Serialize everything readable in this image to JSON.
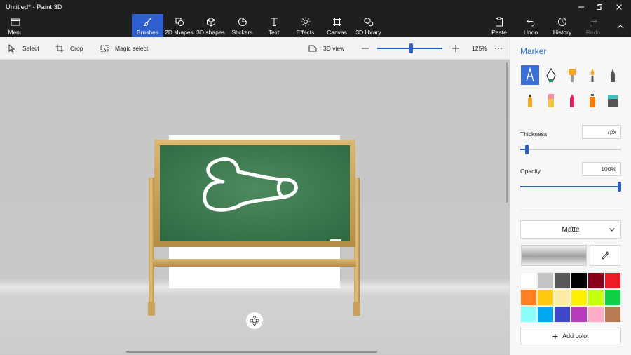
{
  "window": {
    "title": "Untitled* - Paint 3D"
  },
  "ribbon": {
    "menu": "Menu",
    "tools": [
      {
        "id": "brushes",
        "label": "Brushes",
        "icon": "brush-icon",
        "active": true
      },
      {
        "id": "2d-shapes",
        "label": "2D shapes",
        "icon": "2d-shapes-icon"
      },
      {
        "id": "3d-shapes",
        "label": "3D shapes",
        "icon": "cube-icon"
      },
      {
        "id": "stickers",
        "label": "Stickers",
        "icon": "sticker-icon"
      },
      {
        "id": "text",
        "label": "Text",
        "icon": "text-icon"
      },
      {
        "id": "effects",
        "label": "Effects",
        "icon": "sun-icon"
      },
      {
        "id": "canvas",
        "label": "Canvas",
        "icon": "canvas-icon"
      },
      {
        "id": "3d-library",
        "label": "3D library",
        "icon": "library-icon"
      }
    ],
    "paste": "Paste",
    "undo": "Undo",
    "history": "History",
    "redo": "Redo"
  },
  "toolbar": {
    "select": "Select",
    "crop": "Crop",
    "magic_select": "Magic select",
    "view_3d": "3D view",
    "zoom": "125%",
    "zoom_fraction": 0.52
  },
  "panel": {
    "title": "Marker",
    "thickness_label": "Thickness",
    "thickness_value": "7px",
    "thickness_fraction": 0.05,
    "opacity_label": "Opacity",
    "opacity_value": "100%",
    "opacity_fraction": 1.0,
    "finish": "Matte",
    "add_color": "Add color",
    "accent": "#2b5fc7",
    "palette": [
      "#ffffff",
      "#c3c3c3",
      "#585858",
      "#000000",
      "#88001b",
      "#ec1c24",
      "#ff7f27",
      "#ffc90e",
      "#fdeca6",
      "#fff200",
      "#c4ff0e",
      "#0ed145",
      "#8cfffb",
      "#00a8f3",
      "#3f48cc",
      "#b83dba",
      "#ffaec8",
      "#b97a56"
    ]
  }
}
